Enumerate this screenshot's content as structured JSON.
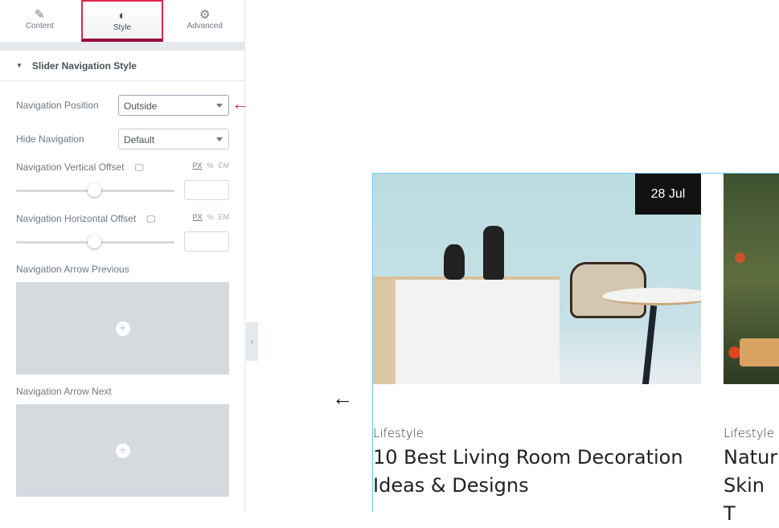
{
  "panel": {
    "tabs": [
      {
        "label": "Content",
        "icon": "pencil-icon"
      },
      {
        "label": "Style",
        "icon": "half-circle-icon"
      },
      {
        "label": "Advanced",
        "icon": "gear-icon"
      }
    ],
    "active_tab": "Style",
    "section_title": "Slider Navigation Style",
    "nav_position": {
      "label": "Navigation Position",
      "value": "Outside"
    },
    "hide_nav": {
      "label": "Hide Navigation",
      "value": "Default"
    },
    "vertical_offset": {
      "label": "Navigation Vertical Offset",
      "units": [
        "PX",
        "%",
        "EM"
      ],
      "value": ""
    },
    "horizontal_offset": {
      "label": "Navigation Horizontal Offset",
      "units": [
        "PX",
        "%",
        "EM"
      ],
      "value": ""
    },
    "arrow_prev": {
      "label": "Navigation Arrow Previous"
    },
    "arrow_next": {
      "label": "Navigation Arrow Next"
    }
  },
  "accent": "#e2264d",
  "preview": {
    "prev_arrow": "←",
    "cards": [
      {
        "date": "28 Jul",
        "category": "Lifestyle",
        "title": "10 Best Living Room Decoration Ideas & Designs"
      },
      {
        "category": "Lifestyle",
        "title": "Natur Skin T"
      }
    ]
  }
}
